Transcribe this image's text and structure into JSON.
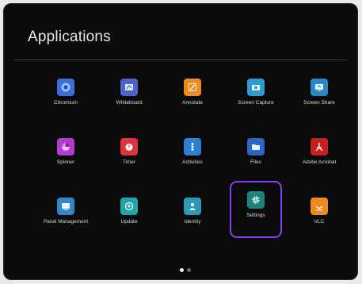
{
  "header": {
    "title": "Applications"
  },
  "apps": [
    {
      "label": "Chromium",
      "icon": "chromium-icon",
      "color": "#3b6fd6"
    },
    {
      "label": "Whiteboard",
      "icon": "whiteboard-icon",
      "color": "#4d63c9"
    },
    {
      "label": "Annotate",
      "icon": "annotate-icon",
      "color": "#f08a1c"
    },
    {
      "label": "Screen Capture",
      "icon": "camera-icon",
      "color": "#2f9ad0"
    },
    {
      "label": "Screen Share",
      "icon": "screen-share-icon",
      "color": "#2a86c9"
    },
    {
      "label": "Spinner",
      "icon": "spinner-icon",
      "color": "#b53ad1"
    },
    {
      "label": "Timer",
      "icon": "timer-icon",
      "color": "#e0333a"
    },
    {
      "label": "Activities",
      "icon": "activities-icon",
      "color": "#2f7fd1"
    },
    {
      "label": "Files",
      "icon": "folder-icon",
      "color": "#2b67c8"
    },
    {
      "label": "Adobe Acrobat",
      "icon": "acrobat-icon",
      "color": "#c62121"
    },
    {
      "label": "Panel Management",
      "icon": "panel-icon",
      "color": "#2f86c9"
    },
    {
      "label": "Update",
      "icon": "update-icon",
      "color": "#1fa5a8"
    },
    {
      "label": "Identity",
      "icon": "identity-icon",
      "color": "#2c9ab3"
    },
    {
      "label": "Settings",
      "icon": "gear-icon",
      "color": "#19857e",
      "selected": true
    },
    {
      "label": "VLC",
      "icon": "vlc-icon",
      "color": "#f08a1c"
    }
  ],
  "pagination": {
    "current": 1,
    "total": 2
  },
  "colors": {
    "background": "#0b0b0b",
    "selection": "#8a3cf0"
  }
}
